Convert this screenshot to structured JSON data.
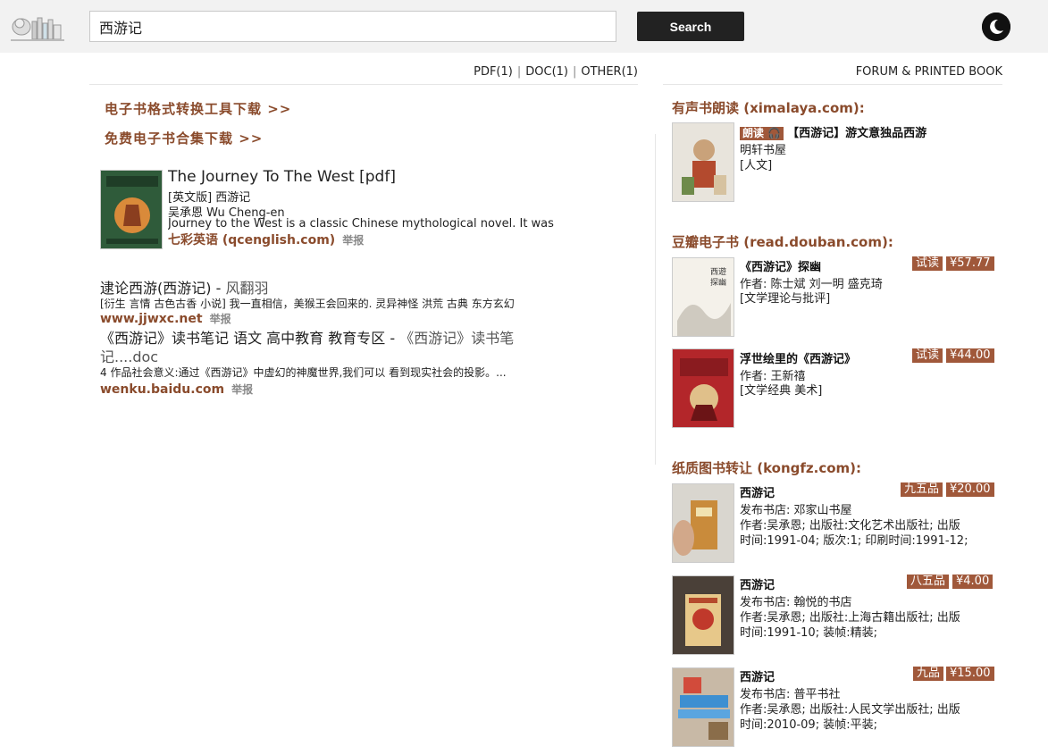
{
  "header": {
    "search_value": "西游记",
    "search_button": "Search"
  },
  "filetypes": {
    "pdf": "PDF(1)",
    "doc": "DOC(1)",
    "other": "OTHER(1)",
    "separator": "|"
  },
  "forum_link": "FORUM & PRINTED BOOK",
  "promos": [
    "电子书格式转换工具下载 >>",
    "免费电子书合集下载 >>"
  ],
  "results": [
    {
      "title": "The Journey To The West [pdf]",
      "line1": "[英文版] 西游记",
      "line2": "吴承恩 Wu Cheng-en",
      "snippet": "Journey to the West is a classic Chinese mythological novel. It was",
      "source": "七彩英语 (qcenglish.com)",
      "report": "举报"
    },
    {
      "title_main": "逮论西游(西游记)",
      "title_dash": " - ",
      "title_author": "风翻羽",
      "snippet": "[衍生 言情 古色古香 小说] 我一直相信，美猴王会回来的. 灵异神怪 洪荒 古典 东方玄幻",
      "source": "www.jjwxc.net",
      "report": "举报"
    },
    {
      "title_main": "《西游记》读书笔记 语文 高中教育 教育专区",
      "title_dash": " - ",
      "title_author": "《西游记》读书笔",
      "title_cont": "记....doc",
      "snippet": "4 作品社会意义:通过《西游记》中虚幻的神魔世界,我们可以 看到现实社会的投影。...",
      "source": "wenku.baidu.com",
      "report": "举报"
    }
  ],
  "audio": {
    "section_title": "有声书朗读 (ximalaya.com):",
    "tag": "朗读",
    "title": "【西游记】游文意独品西游",
    "publisher": "明轩书屋",
    "category": "[人文]"
  },
  "douban": {
    "section_title": "豆瓣电子书 (read.douban.com):",
    "books": [
      {
        "title": "《西游记》探幽",
        "author": "作者: 陈士斌 刘一明 盛克琦",
        "category": "[文学理论与批评]",
        "trial": "试读",
        "price": "¥57.77"
      },
      {
        "title": "浮世绘里的《西游记》",
        "author": "作者: 王新禧",
        "category": "[文学经典 美术]",
        "trial": "试读",
        "price": "¥44.00"
      }
    ]
  },
  "kongfz": {
    "section_title": "纸质图书转让 (kongfz.com):",
    "books": [
      {
        "title": "西游记",
        "store": "发布书店: 邓家山书屋",
        "info1": "作者:吴承恩; 出版社:文化艺术出版社; 出版",
        "info2": "时间:1991-04; 版次:1; 印刷时间:1991-12;",
        "condition": "九五品",
        "price": "¥20.00"
      },
      {
        "title": "西游记",
        "store": "发布书店: 翰悦的书店",
        "info1": "作者:吴承恩; 出版社:上海古籍出版社; 出版",
        "info2": "时间:1991-10; 装帧:精装;",
        "condition": "八五品",
        "price": "¥4.00"
      },
      {
        "title": "西游记",
        "store": "发布书店: 普平书社",
        "info1": "作者:吴承恩; 出版社:人民文学出版社; 出版",
        "info2": "时间:2010-09; 装帧:平装;",
        "condition": "九品",
        "price": "¥15.00"
      }
    ]
  }
}
